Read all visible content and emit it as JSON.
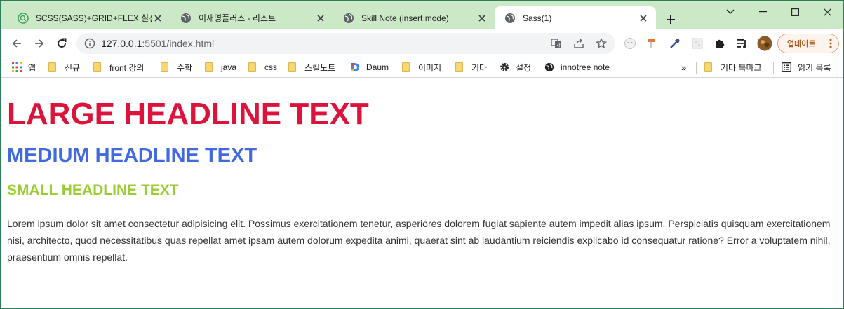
{
  "browser": {
    "tabs": [
      {
        "title": "SCSS(SASS)+GRID+FLEX 실전",
        "favicon": "green-q-icon",
        "active": false
      },
      {
        "title": "이재명플러스 - 리스트",
        "favicon": "globe-icon",
        "active": false
      },
      {
        "title": "Skill Note (insert mode)",
        "favicon": "globe-icon",
        "active": false
      },
      {
        "title": "Sass(1)",
        "favicon": "globe-icon",
        "active": true
      }
    ],
    "new_tab": "+",
    "address": {
      "host": "127.0.0.1",
      "path": ":5501/index.html"
    },
    "update_button": "업데이트",
    "bookmarks": [
      {
        "label": "앱",
        "icon": "apps-grid-icon"
      },
      {
        "label": "신규",
        "icon": "folder-icon"
      },
      {
        "label": "front 강의",
        "icon": "folder-icon"
      },
      {
        "label": "수학",
        "icon": "folder-icon"
      },
      {
        "label": "java",
        "icon": "folder-icon"
      },
      {
        "label": "css",
        "icon": "folder-icon"
      },
      {
        "label": "스킬노트",
        "icon": "folder-icon"
      },
      {
        "label": "Daum",
        "icon": "daum-icon"
      },
      {
        "label": "이미지",
        "icon": "folder-icon"
      },
      {
        "label": "기타",
        "icon": "folder-icon"
      },
      {
        "label": "설정",
        "icon": "gear-icon"
      },
      {
        "label": "innotree note",
        "icon": "globe-icon"
      }
    ],
    "overflow": "»",
    "other_bookmarks": "기타 북마크",
    "reading_list": "읽기 목록"
  },
  "page": {
    "large_headline": "LARGE HEADLINE TEXT",
    "medium_headline": "MEDIUM HEADLINE TEXT",
    "small_headline": "SMALL HEADLINE TEXT",
    "paragraph": "Lorem ipsum dolor sit amet consectetur adipisicing elit. Possimus exercitationem tenetur, asperiores dolorem fugiat sapiente autem impedit alias ipsum. Perspiciatis quisquam exercitationem nisi, architecto, quod necessitatibus quas repellat amet ipsam autem dolorum expedita animi, quaerat sint ab laudantium reiciendis explicabo id consequatur ratione? Error a voluptatem nihil, praesentium omnis repellat."
  },
  "colors": {
    "large": "#dc143c",
    "medium": "#4169e1",
    "small": "#9acd32",
    "tabstrip": "#cbe9c6"
  }
}
